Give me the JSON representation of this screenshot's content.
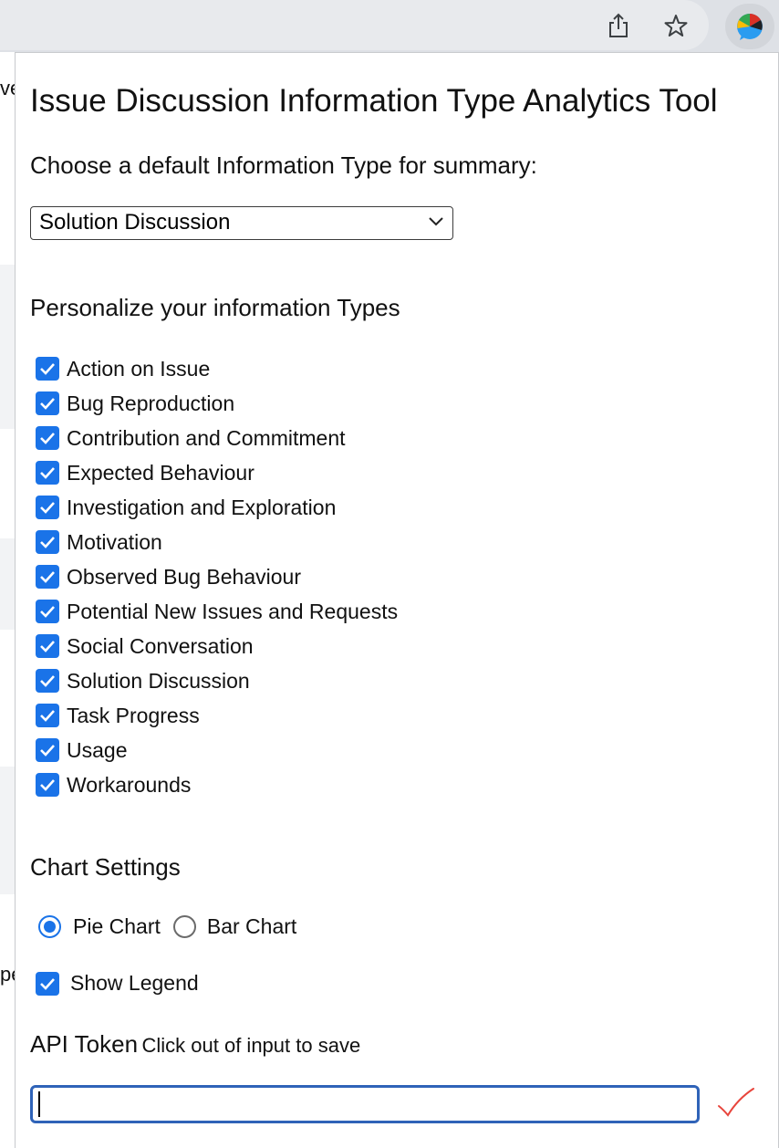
{
  "toolbar": {
    "share_icon": "share-icon",
    "bookmark_icon": "star-icon",
    "extension_icon": "extension-pie-logo-icon"
  },
  "background_page": {
    "fragment_top": "ve",
    "fragment_mid": "pe"
  },
  "popup": {
    "title": "Issue Discussion Information Type Analytics Tool",
    "default_type_label": "Choose a default Information Type for summary:",
    "default_type_selected": "Solution Discussion",
    "personalize_title": "Personalize your information Types",
    "information_types": [
      {
        "label": "Action on Issue",
        "checked": true
      },
      {
        "label": "Bug Reproduction",
        "checked": true
      },
      {
        "label": "Contribution and Commitment",
        "checked": true
      },
      {
        "label": "Expected Behaviour",
        "checked": true
      },
      {
        "label": "Investigation and Exploration",
        "checked": true
      },
      {
        "label": "Motivation",
        "checked": true
      },
      {
        "label": "Observed Bug Behaviour",
        "checked": true
      },
      {
        "label": "Potential New Issues and Requests",
        "checked": true
      },
      {
        "label": "Social Conversation",
        "checked": true
      },
      {
        "label": "Solution Discussion",
        "checked": true
      },
      {
        "label": "Task Progress",
        "checked": true
      },
      {
        "label": "Usage",
        "checked": true
      },
      {
        "label": "Workarounds",
        "checked": true
      }
    ],
    "chart_settings_title": "Chart Settings",
    "chart_types": [
      {
        "label": "Pie Chart",
        "selected": true
      },
      {
        "label": "Bar Chart",
        "selected": false
      }
    ],
    "show_legend_label": "Show Legend",
    "show_legend_checked": true,
    "api_token_title": "API Token",
    "api_token_hint": "Click out of input to save",
    "api_token_value": ""
  },
  "colors": {
    "accent": "#1a73e8",
    "input_focus_border": "#2f63b8",
    "saved_check": "#e8453c"
  }
}
